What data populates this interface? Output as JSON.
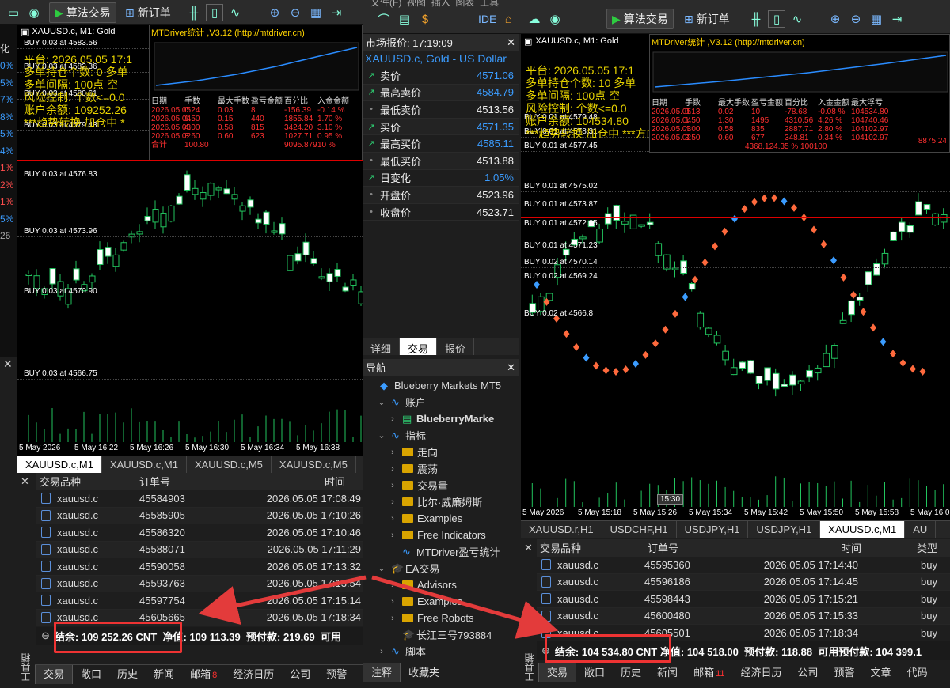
{
  "toolbar": {
    "algo_trading": "算法交易",
    "new_order": "新订单",
    "ide": "IDE",
    "menu_partial": [
      "文件(F)",
      "视图",
      "插入",
      "图表",
      "工具"
    ]
  },
  "left_window": {
    "title": "XAUUSD.c, M1:  Gold",
    "stats_header": "MTDriver统计 ,V3.12 (http://mtdriver.cn)",
    "yellow_lines": [
      "平台: 2026.05.05 17:1",
      "多单持仓个数: 0   多单",
      "多单间隔: 100点   空",
      "风险控制: 个数<=0.0",
      "账户余额: 109252.26",
      "***趋势转换 加仓中 *"
    ],
    "side_percents": [
      "0%",
      "5%",
      "7%",
      "8%",
      "5%",
      "4%",
      "1%",
      "2%",
      "1%",
      "5%",
      "26"
    ],
    "side_label": "化",
    "stats_cols": [
      "日期",
      "手数",
      "最大手数",
      "盈亏金额",
      "百分比",
      "入金金额"
    ],
    "stats_rows": [
      [
        "2026.05.05",
        "0.24",
        "0.03",
        "8",
        "-156.39",
        "-0.14 %"
      ],
      [
        "2026.05.04",
        "1.50",
        "0.15",
        "440",
        "1855.84",
        "1.70 %"
      ],
      [
        "2026.05.03",
        "4.00",
        "0.58",
        "815",
        "3424.20",
        "3.10 %"
      ],
      [
        "2026.05.02",
        "3.60",
        "0.60",
        "623",
        "1027.71",
        "0.95 %"
      ]
    ],
    "stats_total": [
      "合计",
      "100.80",
      "",
      "",
      "9095.879",
      "10 %"
    ],
    "orders": [
      "BUY 0.03 at 4583.56",
      "BUY 0.03 at 4582.36",
      "BUY 0.03 at 4580.61",
      "BUY 0.03 at 4579.43",
      "BUY 0.03 at 4576.83",
      "BUY 0.03 at 4573.96",
      "BUY 0.03 at 4570.90",
      "BUY 0.03 at 4566.75"
    ],
    "time_axis": [
      "5 May 2026",
      "5 May 16:22",
      "5 May 16:26",
      "5 May 16:30",
      "5 May 16:34",
      "5 May 16:38"
    ],
    "chart_tabs": [
      "XAUUSD.c,M1",
      "XAUUSD.c,M1",
      "XAUUSD.c,M5",
      "XAUUSD.c,M5"
    ],
    "table_headers": [
      "交易品种",
      "订单号",
      "时间"
    ],
    "table_rows": [
      [
        "xauusd.c",
        "45584903",
        "2026.05.05 17:08:49"
      ],
      [
        "xauusd.c",
        "45585905",
        "2026.05.05 17:10:26"
      ],
      [
        "xauusd.c",
        "45586320",
        "2026.05.05 17:10:46"
      ],
      [
        "xauusd.c",
        "45588071",
        "2026.05.05 17:11:29"
      ],
      [
        "xauusd.c",
        "45590058",
        "2026.05.05 17:13:32"
      ],
      [
        "xauusd.c",
        "45593763",
        "2026.05.05 17:13:54"
      ],
      [
        "xauusd.c",
        "45597754",
        "2026.05.05 17:15:14"
      ],
      [
        "xauusd.c",
        "45605665",
        "2026.05.05 17:18:34"
      ]
    ],
    "balance_line": {
      "balance": "结余: 109 252.26 CNT",
      "equity": "净值: 109 113.39",
      "margin": "预付款: 219.69",
      "free": "可用"
    },
    "bottom_tabs": [
      "交易",
      "敞口",
      "历史",
      "新闻",
      "邮箱",
      "经济日历",
      "公司",
      "预警"
    ],
    "mail_count": "8",
    "toolbox": "工具箱"
  },
  "market_watch": {
    "title": "市场报价: 17:19:09",
    "symbol": "XAUUSD.c, Gold - US Dollar",
    "rows": [
      [
        "卖价",
        "4571.06",
        "blue"
      ],
      [
        "最高卖价",
        "4584.79",
        "blue"
      ],
      [
        "最低卖价",
        "4513.56",
        "white"
      ],
      [
        "买价",
        "4571.35",
        "blue"
      ],
      [
        "最高买价",
        "4585.11",
        "blue"
      ],
      [
        "最低买价",
        "4513.88",
        "white"
      ],
      [
        "日变化",
        "1.05%",
        "blue"
      ],
      [
        "开盘价",
        "4523.96",
        "white"
      ],
      [
        "收盘价",
        "4523.71",
        "white"
      ]
    ],
    "tabs": [
      "详细",
      "交易",
      "报价"
    ]
  },
  "navigator": {
    "title": "导航",
    "items": [
      [
        "Blueberry Markets MT5",
        0,
        "root"
      ],
      [
        "账户",
        1,
        "open"
      ],
      [
        "BlueberryMarke",
        2,
        "acct"
      ],
      [
        "指标",
        1,
        "open"
      ],
      [
        "走向",
        2,
        "f"
      ],
      [
        "震荡",
        2,
        "f"
      ],
      [
        "交易量",
        2,
        "f"
      ],
      [
        "比尔·威廉姆斯",
        2,
        "f"
      ],
      [
        "Examples",
        2,
        "f"
      ],
      [
        "Free Indicators",
        2,
        "f"
      ],
      [
        "MTDriver盈亏统计",
        2,
        "ind"
      ],
      [
        "EA交易",
        1,
        "open"
      ],
      [
        "Advisors",
        2,
        "f"
      ],
      [
        "Examples",
        2,
        "f"
      ],
      [
        "Free Robots",
        2,
        "f"
      ],
      [
        "长江三号793884",
        2,
        "ea"
      ],
      [
        "脚本",
        1,
        "closed"
      ]
    ],
    "tabs": [
      "注释",
      "收藏夹"
    ]
  },
  "right_window": {
    "title": "XAUUSD.c, M1:  Gold",
    "stats_header": "MTDriver统计 ,V3.12 (http://mtdriver.cn)",
    "overlay_lines": [
      "平台: 2026.05.05 17:1",
      "多单持仓个数: 10  多单",
      "多单间隔: 100点   空",
      "风险控制: 个数<=0.0",
      "账户余额: 104534.80",
      "***趋势转换 加仓中 ***方向 多单"
    ],
    "stats_cols": [
      "日期",
      "手数",
      "最大手数",
      "盈亏金额",
      "百分比",
      "入金金额",
      "最大浮亏"
    ],
    "stats_rows": [
      [
        "2026.05.05",
        "0.13",
        "0.02",
        "10",
        "-78.68",
        "-0.08 %",
        "104534.80"
      ],
      [
        "2026.05.04",
        "1.50",
        "1.30",
        "1495",
        "4310.56",
        "4.26 %",
        "104740.46"
      ],
      [
        "2026.05.03",
        "4.00",
        "0.58",
        "835",
        "2887.71",
        "2.80 %",
        "104102.97"
      ],
      [
        "2026.05.02",
        "3.50",
        "0.60",
        "677",
        "348.81",
        "0.34 %",
        "104102.97"
      ]
    ],
    "stats_total": "4368.124.35 % 100100",
    "stats_total2": "8875.24",
    "orders": [
      "BUY 0.01 at 4579.48",
      "BUY 0.01 at 4578.31",
      "BUY 0.01 at 4577.45",
      "BUY 0.01 at 4575.02",
      "BUY 0.01 at 4573.87",
      "BUY 0.01 at 4572.65",
      "BUY 0.01 at 4571.23",
      "BUY 0.02 at 4570.14",
      "BUY 0.02 at 4569.24",
      "BUY 0.02 at 4566.8"
    ],
    "time_axis": [
      "5 May 2026",
      "5 May 15:18",
      "5 May 15:26",
      "5 May 15:34",
      "5 May 15:42",
      "5 May 15:50",
      "5 May 15:58",
      "5 May 16:0"
    ],
    "time_marker": "15:30",
    "chart_tabs": [
      "XAUUSD.r,H1",
      "USDCHF,H1",
      "USDJPY,H1",
      "USDJPY,H1",
      "XAUUSD.c,M1",
      "AU"
    ],
    "table_headers": [
      "交易品种",
      "订单号",
      "时间",
      "类型"
    ],
    "table_rows": [
      [
        "xauusd.c",
        "45595360",
        "2026.05.05 17:14:40",
        "buy"
      ],
      [
        "xauusd.c",
        "45596186",
        "2026.05.05 17:14:45",
        "buy"
      ],
      [
        "xauusd.c",
        "45598443",
        "2026.05.05 17:15:21",
        "buy"
      ],
      [
        "xauusd.c",
        "45600480",
        "2026.05.05 17:15:33",
        "buy"
      ],
      [
        "xauusd.c",
        "45605501",
        "2026.05.05 17:18:34",
        "buy"
      ]
    ],
    "balance_line": {
      "balance": "结余: 104 534.80 CNT",
      "equity": "净值: 104 518.00",
      "margin": "预付款: 118.88",
      "free": "可用预付款: 104 399.1"
    },
    "bottom_tabs": [
      "交易",
      "敞口",
      "历史",
      "新闻",
      "邮箱",
      "经济日历",
      "公司",
      "预警",
      "文章",
      "代码"
    ],
    "mail_count": "11",
    "toolbox": "工具箱"
  },
  "colors": {
    "accent_blue": "#3b9cff",
    "arrow_red": "#e33b3b",
    "bull": "#ffffff",
    "bear": "#000000",
    "grid_text": "#ffffff",
    "stats_yellow": "#e6d200",
    "stats_red": "#ff3030"
  }
}
